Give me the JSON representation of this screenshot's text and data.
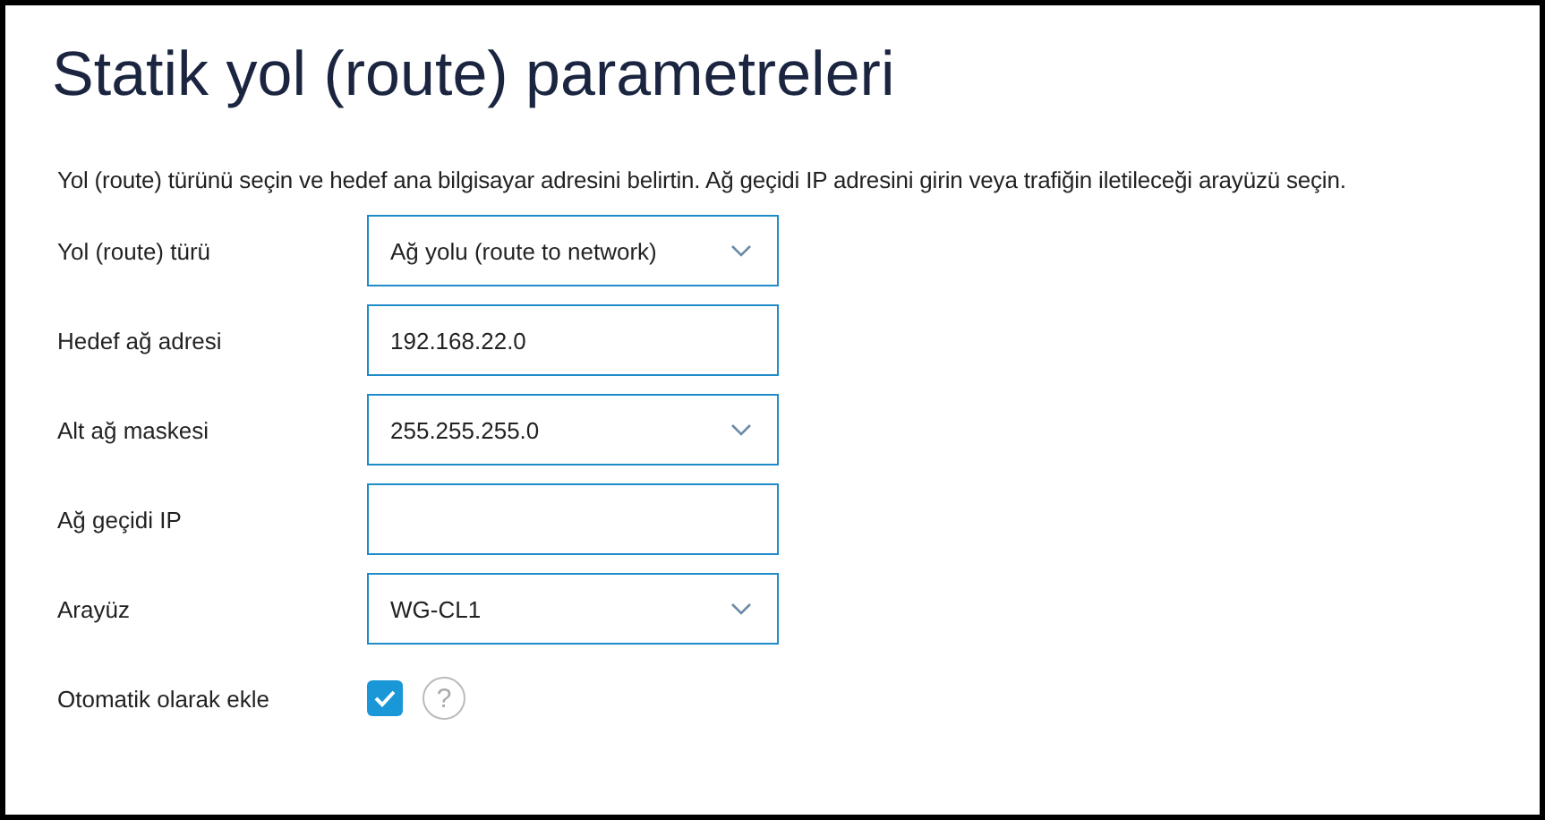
{
  "title": "Statik yol (route) parametreleri",
  "description": "Yol (route) türünü seçin ve hedef ana bilgisayar adresini belirtin. Ağ geçidi IP adresini girin veya trafiğin iletileceği arayüzü seçin.",
  "fields": [
    {
      "kind": "select",
      "label": "Yol (route) türü",
      "value": "Ağ yolu (route to network)"
    },
    {
      "kind": "input",
      "label": "Hedef ağ adresi",
      "value": "192.168.22.0"
    },
    {
      "kind": "select",
      "label": "Alt ağ maskesi",
      "value": "255.255.255.0"
    },
    {
      "kind": "input",
      "label": "Ağ geçidi IP"
    },
    {
      "kind": "select",
      "label": "Arayüz",
      "value": "WG-CL1"
    },
    {
      "kind": "checkbox",
      "label": "Otomatik olarak ekle",
      "checked": true,
      "help": "?"
    }
  ]
}
